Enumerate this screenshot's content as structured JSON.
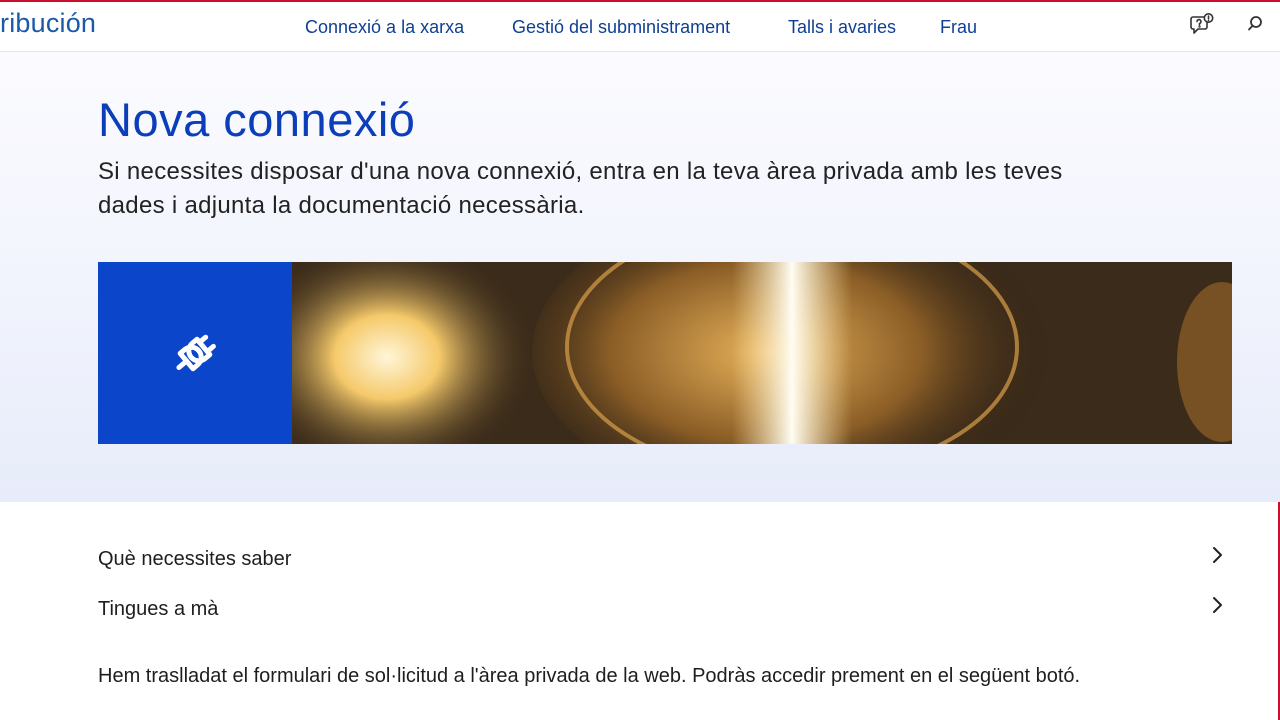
{
  "header": {
    "brand": "ribución",
    "nav": [
      {
        "label": "Connexió a la xarxa"
      },
      {
        "label": "Gestió del subministrament"
      },
      {
        "label": "Talls i avaries"
      },
      {
        "label": "Frau"
      }
    ],
    "icons": [
      "chat-help-icon",
      "search-icon"
    ]
  },
  "hero": {
    "title": "Nova connexió",
    "subtitle": "Si necessites disposar d'una nova connexió, entra en la teva àrea privada amb les teves dades i adjunta la documentació necessària.",
    "banner_icon": "plug-connection-icon",
    "banner_color": "#0b45c9"
  },
  "accordion": [
    {
      "label": "Què necessites saber"
    },
    {
      "label": "Tingues a mà"
    }
  ],
  "info_text": "Hem traslladat el formulari de sol·licitud a l'àrea privada de la web. Podràs accedir prement en el següent botó.",
  "colors": {
    "accent": "#0b3eb8",
    "nav": "#0f3f94",
    "frame": "#c8102e"
  }
}
